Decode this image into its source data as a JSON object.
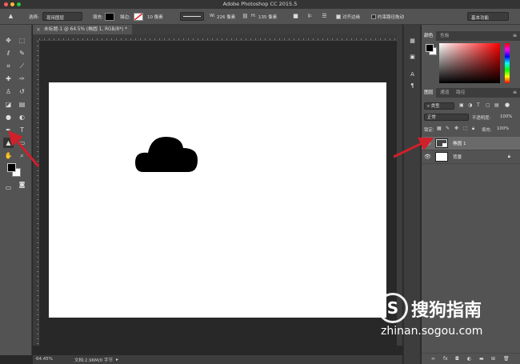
{
  "app": {
    "window_title": "Adobe Photoshop CC 2015.5",
    "traffic_colors": [
      "#ff5f57",
      "#febc2e",
      "#28c840"
    ]
  },
  "options_bar": {
    "select_label": "选择:",
    "select_value": "现用图层",
    "fill_label": "填充:",
    "fill_color": "#000000",
    "stroke_label": "描边:",
    "stroke_size": "10 像素",
    "w_label": "W:",
    "w_value": "226 像素",
    "h_label": "H:",
    "h_value": "135 像素",
    "align_edges_label": "对齐边缘",
    "align_edges_checked": true,
    "constrain_label": "约束路径拖动",
    "constrain_checked": false,
    "workspace": "基本功能"
  },
  "tools": [
    {
      "name": "move-tool",
      "glyph": "✥"
    },
    {
      "name": "marquee-tool",
      "glyph": "⬚"
    },
    {
      "name": "lasso-tool",
      "glyph": "ℓ"
    },
    {
      "name": "quick-select-tool",
      "glyph": "✎"
    },
    {
      "name": "crop-tool",
      "glyph": "⌗"
    },
    {
      "name": "eyedropper-tool",
      "glyph": "⟋"
    },
    {
      "name": "healing-tool",
      "glyph": "✚"
    },
    {
      "name": "brush-tool",
      "glyph": "✑"
    },
    {
      "name": "clone-stamp-tool",
      "glyph": "♙"
    },
    {
      "name": "history-brush-tool",
      "glyph": "↺"
    },
    {
      "name": "eraser-tool",
      "glyph": "◪"
    },
    {
      "name": "gradient-tool",
      "glyph": "▤"
    },
    {
      "name": "blur-tool",
      "glyph": "●"
    },
    {
      "name": "dodge-tool",
      "glyph": "◐"
    },
    {
      "name": "pen-tool",
      "glyph": "✒"
    },
    {
      "name": "type-tool",
      "glyph": "T"
    },
    {
      "name": "path-select-tool",
      "glyph": "▲"
    },
    {
      "name": "shape-tool",
      "glyph": "▭"
    },
    {
      "name": "hand-tool",
      "glyph": "✋"
    },
    {
      "name": "zoom-tool",
      "glyph": "⌕"
    }
  ],
  "document": {
    "tab_title": "未标题-1 @ 64.5% (椭圆 1, RGB/8*) *",
    "close_glyph": "×"
  },
  "status": {
    "zoom": "64.45%",
    "doc_info": "文档:2.96M/0 字节"
  },
  "color_panel": {
    "tab_color": "颜色",
    "tab_swatches": "色板",
    "fg_color": "#000000",
    "bg_color": "#ffffff"
  },
  "layers_panel": {
    "tab_layers": "图层",
    "tab_channels": "通道",
    "tab_paths": "路径",
    "filter_kind": "类型",
    "blend_mode": "正常",
    "opacity_label": "不透明度:",
    "opacity_value": "100%",
    "lock_label": "锁定:",
    "fill_label": "填充:",
    "fill_value": "100%",
    "layers": [
      {
        "name": "椭圆 1",
        "selected": true
      },
      {
        "name": "背景",
        "selected": false,
        "locked": true
      }
    ]
  },
  "watermark": {
    "logo_letter": "S",
    "brand": "搜狗指南",
    "url": "zhinan.sogou.com"
  },
  "annotation": {
    "arrow_color": "#d0202a"
  }
}
